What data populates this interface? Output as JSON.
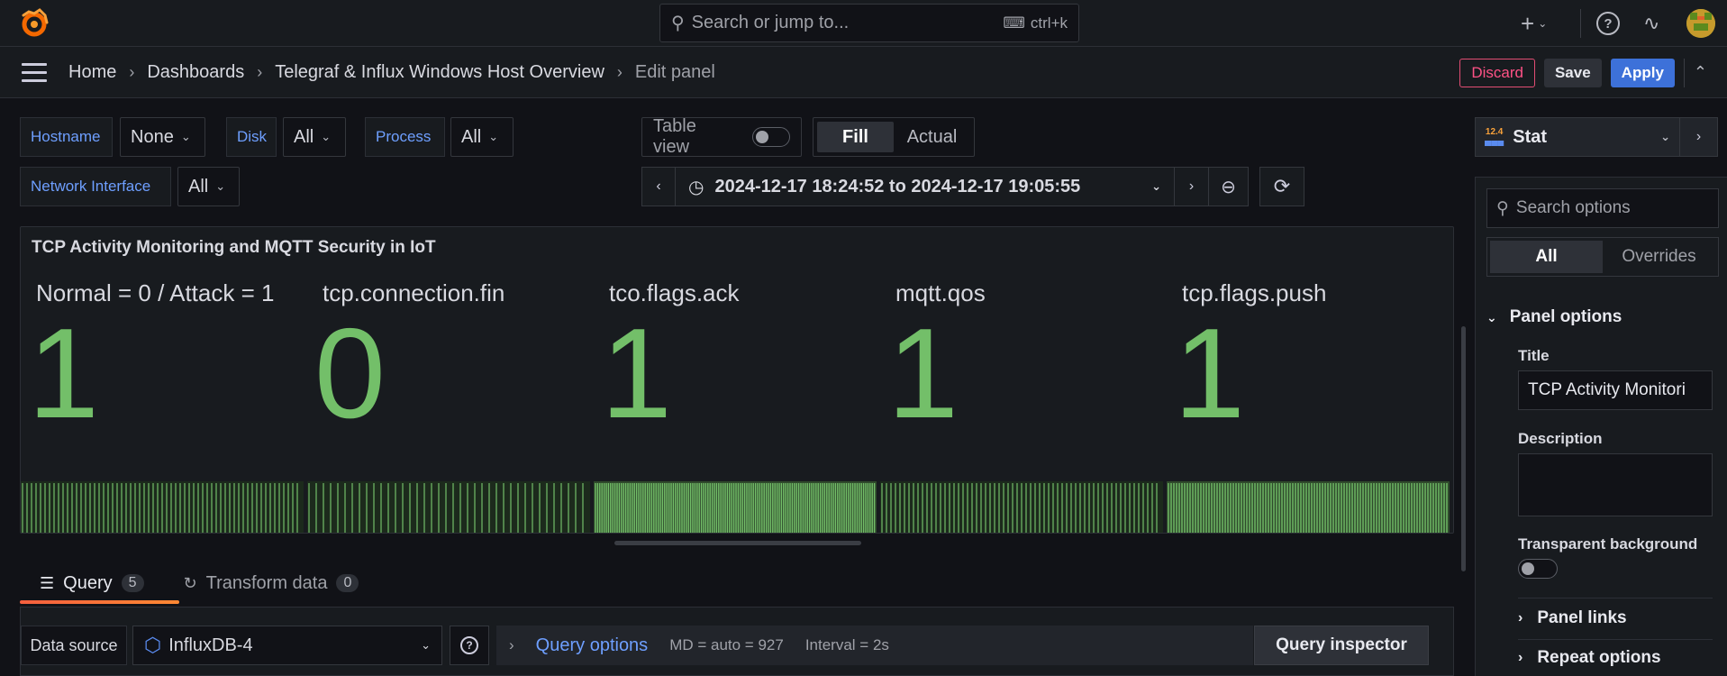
{
  "topbar": {
    "search_placeholder": "Search or jump to...",
    "shortcut": "ctrl+k",
    "plus_label": "+"
  },
  "breadcrumb": {
    "items": [
      "Home",
      "Dashboards",
      "Telegraf & Influx Windows Host Overview",
      "Edit panel"
    ]
  },
  "actions": {
    "discard": "Discard",
    "save": "Save",
    "apply": "Apply"
  },
  "variables": [
    {
      "label": "Hostname",
      "value": "None"
    },
    {
      "label": "Disk",
      "value": "All"
    },
    {
      "label": "Process",
      "value": "All"
    },
    {
      "label": "Network Interface",
      "value": "All"
    }
  ],
  "view": {
    "table_view_label": "Table view",
    "fill": "Fill",
    "actual": "Actual"
  },
  "timerange": {
    "text": "2024-12-17 18:24:52 to 2024-12-17 19:05:55"
  },
  "panel": {
    "title": "TCP Activity Monitoring and MQTT Security in IoT",
    "stats": [
      {
        "label": "Normal = 0 / Attack = 1",
        "value": "1"
      },
      {
        "label": "tcp.connection.fin",
        "value": "0"
      },
      {
        "label": "tco.flags.ack",
        "value": "1"
      },
      {
        "label": "mqtt.qos",
        "value": "1"
      },
      {
        "label": "tcp.flags.push",
        "value": "1"
      }
    ],
    "value_color": "#73bf69"
  },
  "query_tabs": [
    {
      "label": "Query",
      "count": "5"
    },
    {
      "label": "Transform data",
      "count": "0"
    }
  ],
  "query_row": {
    "data_source_label": "Data source",
    "data_source": "InfluxDB-4",
    "query_options": "Query options",
    "md": "MD = auto = 927",
    "interval": "Interval = 2s",
    "inspector": "Query inspector"
  },
  "options_pane": {
    "viz": "Stat",
    "viz_version": "12.4",
    "search_placeholder": "Search options",
    "tab_all": "All",
    "tab_overrides": "Overrides",
    "section": "Panel options",
    "title_label": "Title",
    "title_value": "TCP Activity Monitori",
    "description_label": "Description",
    "transparent_label": "Transparent background",
    "panel_links": "Panel links",
    "repeat_options": "Repeat options"
  }
}
